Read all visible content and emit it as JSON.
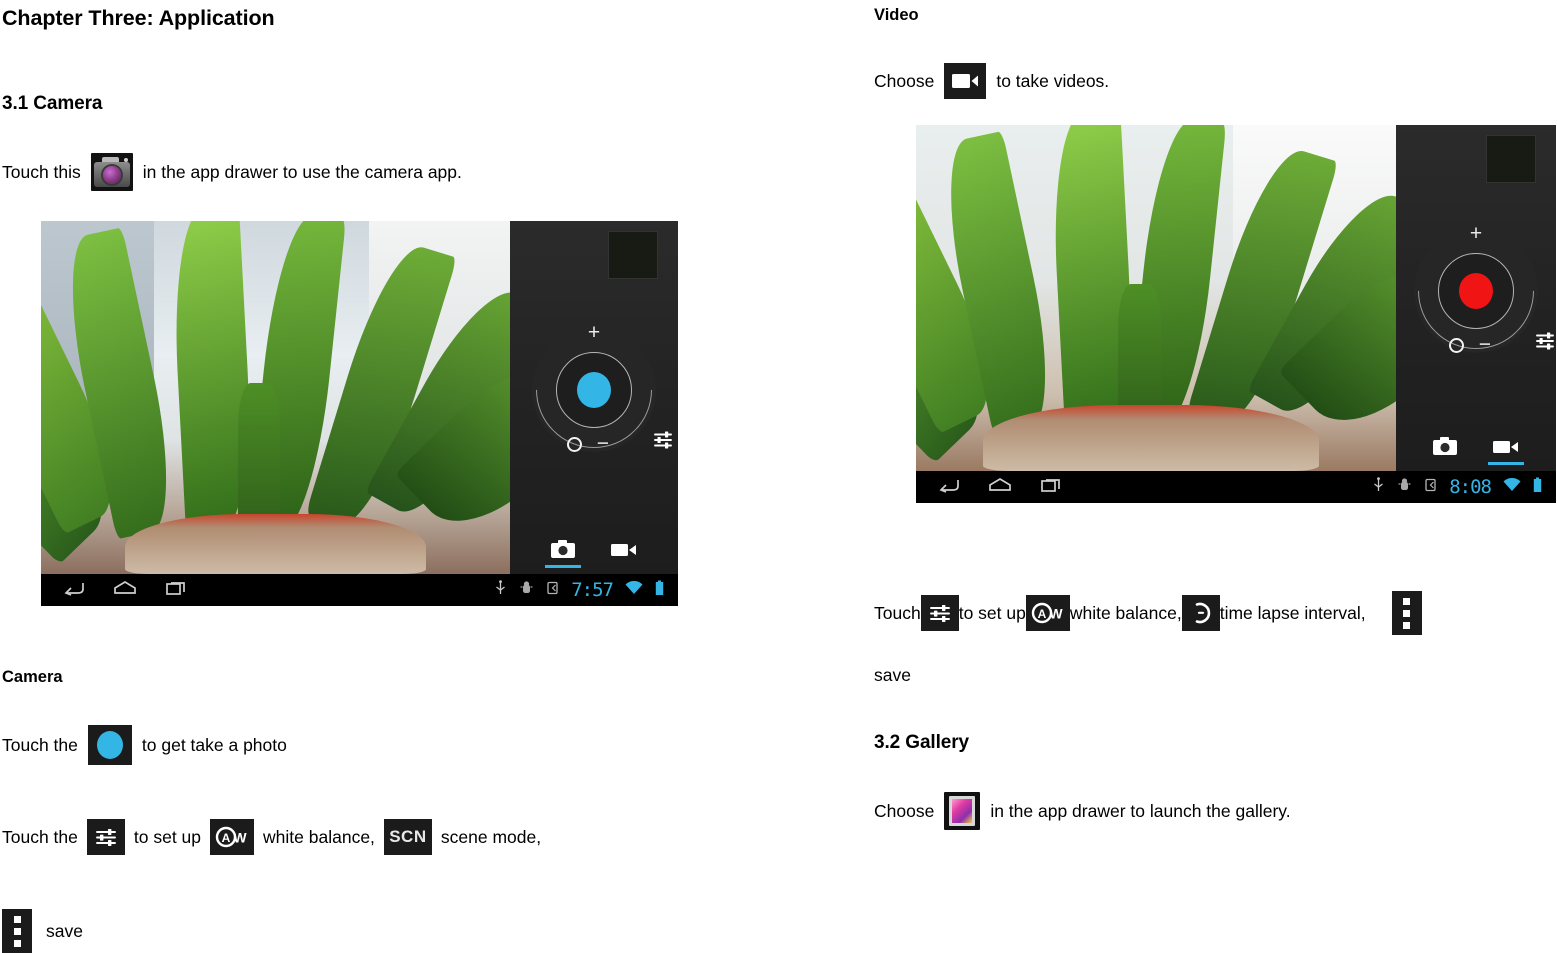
{
  "document": {
    "chapter_title": "Chapter Three: Application"
  },
  "left_column": {
    "section_heading": "3.1 Camera",
    "intro": {
      "before_icon": "Touch this",
      "after_icon": "in the app drawer to use the camera app.",
      "icon": "camera-app-icon"
    },
    "camera_screenshot": {
      "clock": "7:57",
      "shutter_color": "#33b5e5",
      "active_mode": "photo",
      "nav_icons": [
        "back-icon",
        "home-icon",
        "recents-icon"
      ],
      "status_icons": [
        "usb-icon",
        "android-debug-icon",
        "sdcard-icon",
        "wifi-icon",
        "battery-icon"
      ],
      "dial": {
        "zoom_in": "+",
        "zoom_out": "−",
        "settings_icon": "settings-sliders-icon"
      },
      "mode_tabs": [
        "photo-mode-icon",
        "video-mode-icon"
      ]
    },
    "camera_subheading": "Camera",
    "line_shutter": {
      "before_icon": "Touch the",
      "after_icon": "to get take a photo",
      "icon": "shutter-button-icon"
    },
    "line_settings": {
      "part1": "Touch the",
      "icon1": "settings-sliders-icon",
      "part2": "to set up",
      "icon2": "auto-white-balance-icon",
      "part3": "white balance,",
      "icon3": "scene-mode-icon",
      "part4": "scene mode,"
    },
    "line_save": {
      "icon": "overflow-menu-icon",
      "label": "save"
    },
    "icon_labels": {
      "scene_mode_text": "SCN",
      "white_balance_text": "AW"
    }
  },
  "right_column": {
    "video_subheading": "Video",
    "video_intro": {
      "before_icon": "Choose",
      "after_icon": "to take videos.",
      "icon": "video-camera-icon"
    },
    "video_screenshot": {
      "clock": "8:08",
      "record_color": "#f11414",
      "active_mode": "video",
      "nav_icons": [
        "back-icon",
        "home-icon",
        "recents-icon"
      ],
      "status_icons": [
        "usb-icon",
        "android-debug-icon",
        "sdcard-icon",
        "wifi-icon",
        "battery-icon"
      ],
      "dial": {
        "zoom_in": "+",
        "zoom_out": "−",
        "settings_icon": "settings-sliders-icon"
      },
      "mode_tabs": [
        "photo-mode-icon",
        "video-mode-icon"
      ]
    },
    "line_video_settings": {
      "part1": "Touch",
      "icon1": "settings-sliders-icon",
      "part2": "to set up",
      "icon2": "auto-white-balance-icon",
      "part3": "white balance,",
      "icon3": "time-lapse-icon",
      "part4": "time lapse interval,",
      "icon4": "overflow-menu-icon"
    },
    "line_video_save": "save",
    "gallery_heading": "3.2 Gallery",
    "gallery_intro": {
      "before_icon": "Choose",
      "after_icon": "in the app drawer to launch the gallery.",
      "icon": "gallery-app-icon"
    }
  },
  "colors": {
    "accent_blue": "#33b5e5",
    "record_red": "#f11414",
    "panel_dark": "#262626",
    "icon_tile": "#1b1b1b"
  }
}
